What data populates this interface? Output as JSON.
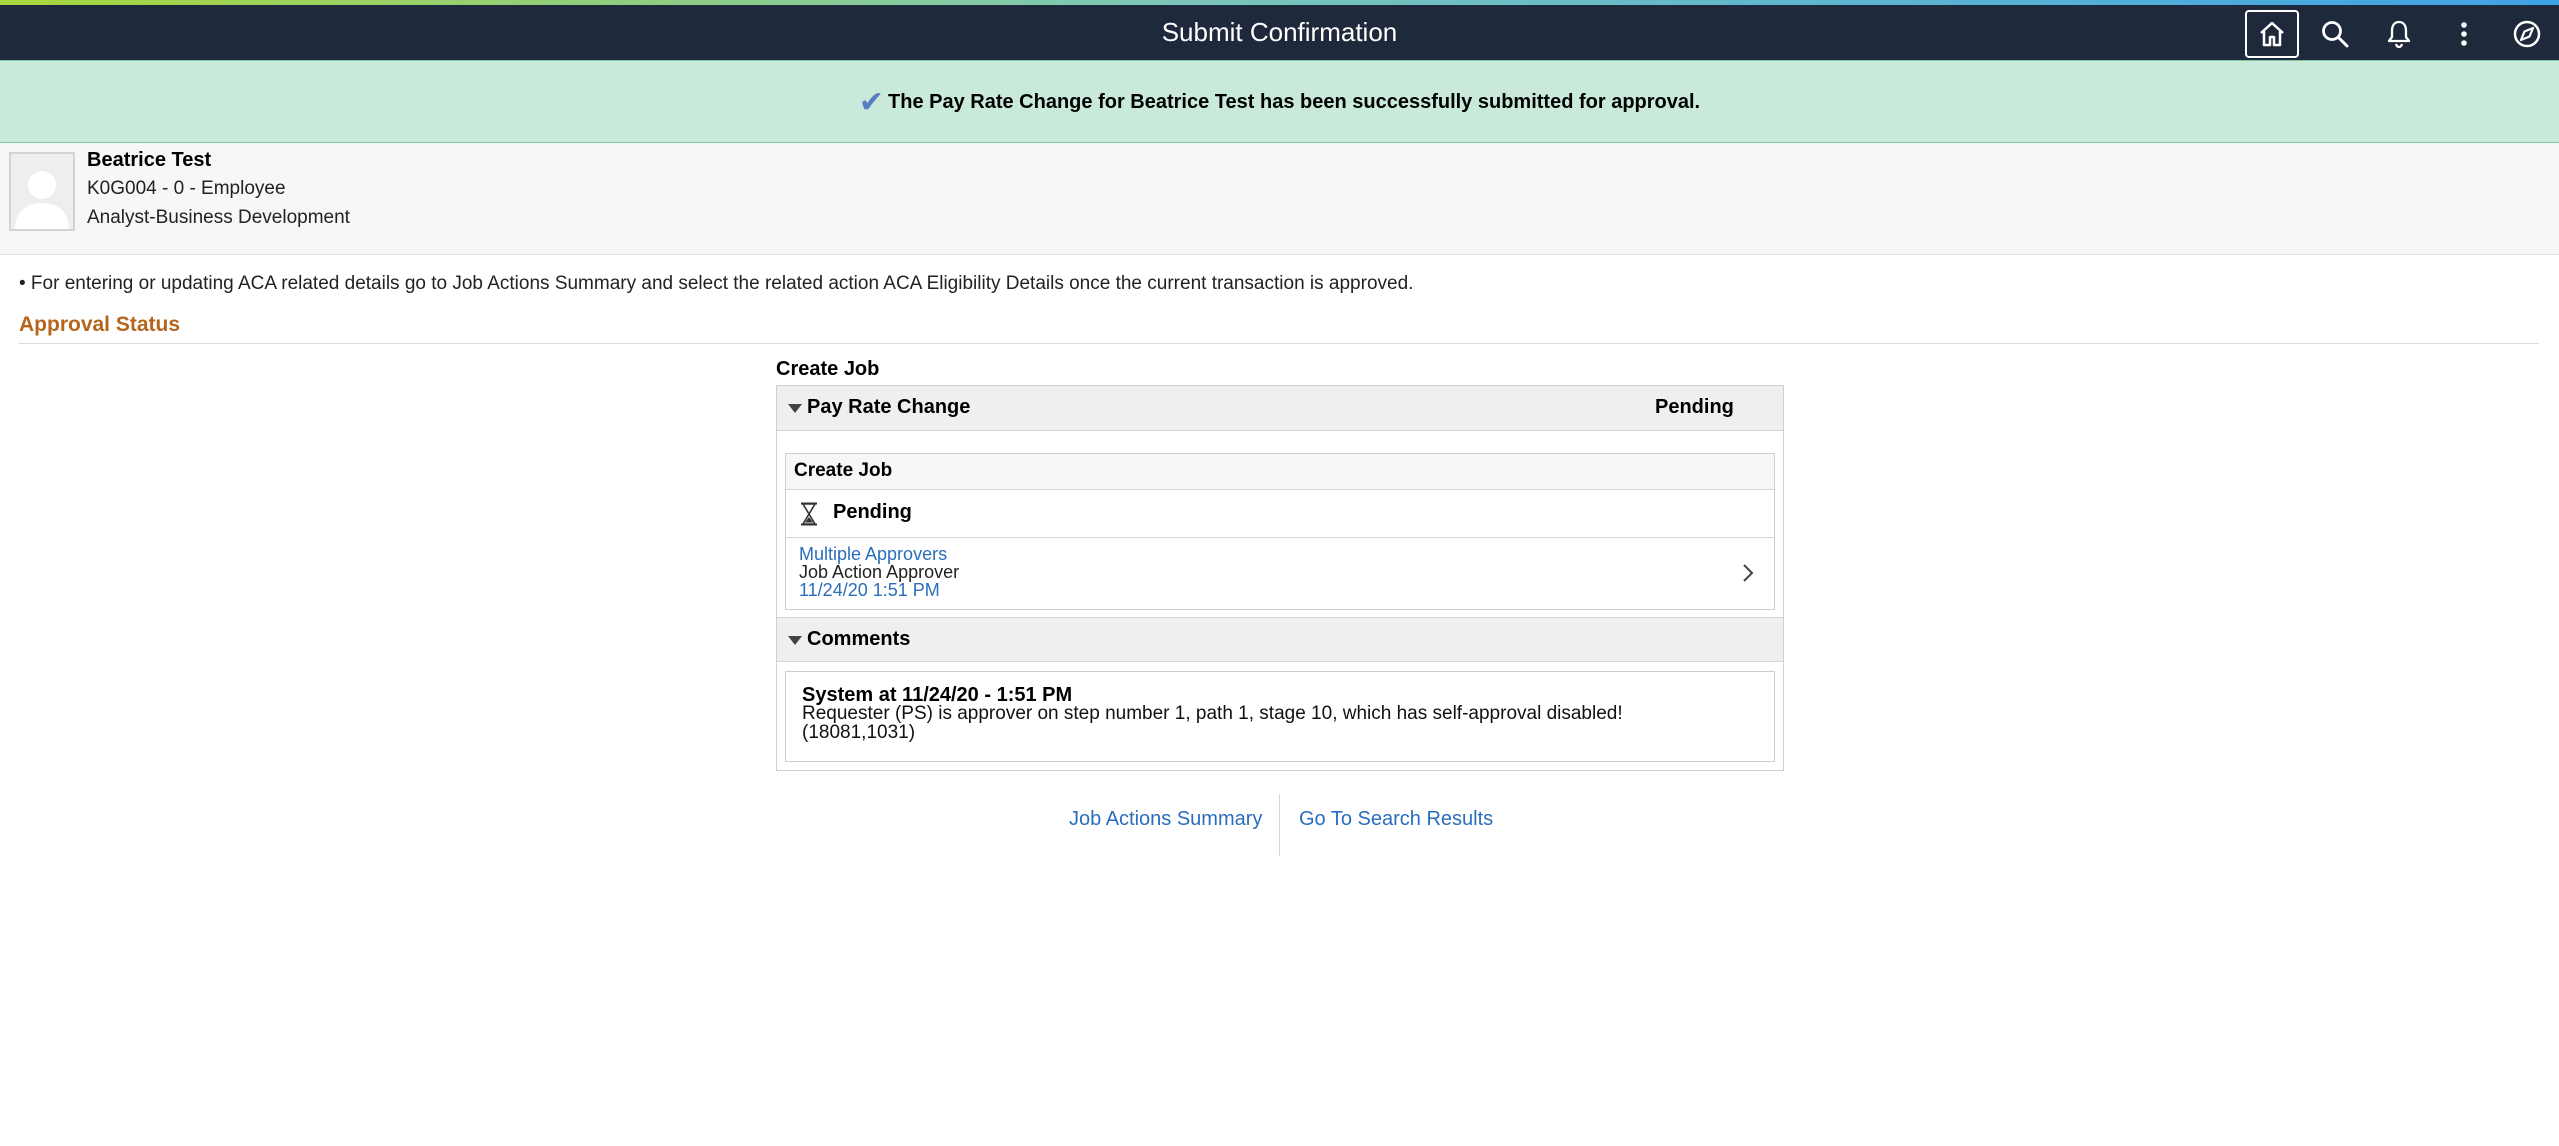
{
  "header": {
    "title": "Submit Confirmation",
    "icons": [
      "home-icon",
      "search-icon",
      "bell-icon",
      "more-vertical-icon",
      "navbar-compass-icon"
    ]
  },
  "banner": {
    "message": "The Pay Rate Change for Beatrice Test has been successfully submitted for approval.",
    "check": "✔"
  },
  "employee": {
    "name": "Beatrice Test",
    "id_line": "K0G004 - 0 - Employee",
    "job_title": "Analyst-Business Development"
  },
  "note": "• For entering or updating ACA related details go to Job Actions Summary and select the related action ACA Eligibility Details once the current transaction is approved.",
  "approval": {
    "section_title": "Approval Status",
    "process_label": "Create Job",
    "panel_title": "Pay Rate Change",
    "panel_status": "Pending",
    "step": {
      "title": "Create Job",
      "status": "Pending",
      "approver_link": "Multiple Approvers",
      "approver_role": "Job Action Approver",
      "approver_date": "11/24/20 1:51 PM"
    },
    "comments": {
      "title": "Comments",
      "author": "System at 11/24/20 - 1:51 PM",
      "text": "Requester (PS) is approver on step number 1, path 1, stage 10, which has self-approval disabled! (18081,1031)"
    }
  },
  "footer": {
    "job_actions_summary": "Job Actions Summary",
    "go_to_search_results": "Go To Search Results"
  },
  "colors": {
    "header_bg": "#1e2a3b",
    "banner_bg": "#c9eadb",
    "section_title": "#b5651d",
    "link": "#2a6ebb"
  }
}
